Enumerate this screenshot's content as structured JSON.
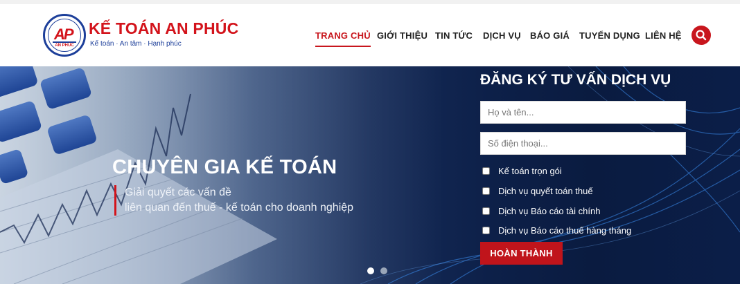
{
  "brand": {
    "name": "KẾ TOÁN AN PHÚC",
    "tagline": "Kế toán · An tâm · Hạnh phúc",
    "logo_mark": "AP",
    "logo_caption": "AN PHÚC",
    "primary_color": "#c8161d",
    "logo_blue": "#1d3f9a"
  },
  "nav": {
    "items": [
      {
        "label": "TRANG CHỦ",
        "active": true
      },
      {
        "label": "GIỚI THIỆU",
        "active": false
      },
      {
        "label": "TIN TỨC",
        "active": false
      },
      {
        "label": "DỊCH VỤ",
        "active": false
      },
      {
        "label": "BÁO GIÁ",
        "active": false
      },
      {
        "label": "TUYỂN DỤNG",
        "active": false
      },
      {
        "label": "LIÊN HỆ",
        "active": false
      }
    ],
    "search_icon": "search-icon"
  },
  "hero": {
    "title": "CHUYÊN GIA KẾ TOÁN",
    "subtitle_line1": "Giải quyết các vấn đề",
    "subtitle_line2": "liên quan đến thuế - kế toán cho doanh nghiệp",
    "slide_count": 2,
    "active_slide": 1
  },
  "form": {
    "title": "ĐĂNG KÝ TƯ VẤN DỊCH VỤ",
    "name_placeholder": "Họ và tên...",
    "phone_placeholder": "Số điện thoại...",
    "options": [
      {
        "label": "Kế toán trọn gói",
        "checked": false
      },
      {
        "label": "Dịch vụ quyết toán thuế",
        "checked": false
      },
      {
        "label": "Dịch vụ Báo cáo tài chính",
        "checked": false
      },
      {
        "label": "Dịch vụ Báo cáo thuế hàng tháng",
        "checked": false
      }
    ],
    "submit_label": "HOÀN THÀNH"
  }
}
